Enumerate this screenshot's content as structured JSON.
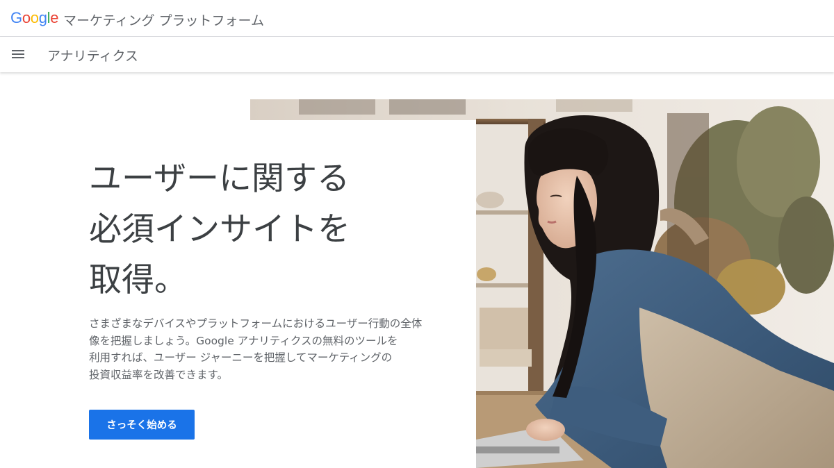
{
  "brand": {
    "logo_letters": [
      {
        "char": "G",
        "color": "#4285F4"
      },
      {
        "char": "o",
        "color": "#EA4335"
      },
      {
        "char": "o",
        "color": "#FBBC05"
      },
      {
        "char": "g",
        "color": "#4285F4"
      },
      {
        "char": "l",
        "color": "#34A853"
      },
      {
        "char": "e",
        "color": "#EA4335"
      }
    ],
    "product_name": "マーケティング プラットフォーム"
  },
  "nav": {
    "menu_icon": "hamburger-menu-icon",
    "section_title": "アナリティクス"
  },
  "hero": {
    "headline_lines": [
      "ユーザーに関する",
      "必須インサイトを",
      "取得。"
    ],
    "description_lines": [
      "さまざまなデバイスやプラットフォームにおけるユーザー行動の全体",
      "像を把握しましょう。Google アナリティクスの無料のツールを",
      "利用すれば、ユーザー ジャーニーを把握してマーケティングの",
      "投資収益率を改善できます。"
    ],
    "cta_label": "さっそく始める",
    "image": "woman-using-laptop-in-cafe"
  },
  "colors": {
    "accent": "#1a73e8",
    "text_primary": "#3c4043",
    "text_secondary": "#5f6368"
  }
}
